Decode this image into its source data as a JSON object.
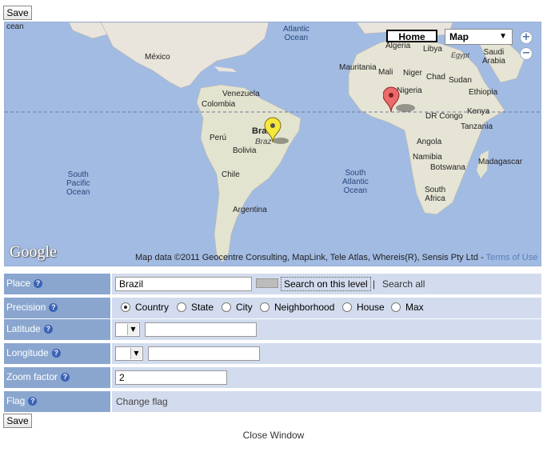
{
  "toolbar": {
    "save_label": "Save"
  },
  "map": {
    "home_label": "Home",
    "map_type": "Map",
    "map_type_arrow": "▼",
    "zoom_in": "+",
    "zoom_out": "−",
    "google_logo": "Google",
    "attribution": "Map data ©2011 Geocentre Consulting, MapLink, Tele Atlas, Whereis(R), Sensis Pty Ltd - ",
    "terms_link": "Terms of Use",
    "labels": {
      "ocean_left": "cean",
      "atlantic_ocean": [
        "Atlantic",
        "Ocean"
      ],
      "mexico": "México",
      "venezuela": "Venezuela",
      "colombia": "Colombia",
      "peru": "Perú",
      "brazil": "Bras",
      "brazil_italic": "Braz",
      "bolivia": "Bolivia",
      "chile": "Chile",
      "argentina": "Argentina",
      "south_pacific": [
        "South",
        "Pacific",
        "Ocean"
      ],
      "south_atlantic": [
        "South",
        "Atlantic",
        "Ocean"
      ],
      "algeria": "Algeria",
      "libya": "Libya",
      "egypt": "Egypt",
      "saudi_arabia": [
        "Saudi",
        "Arabia"
      ],
      "mauritania": "Mauritania",
      "mali": "Mali",
      "niger": "Niger",
      "chad": "Chad",
      "sudan": "Sudan",
      "nigeria": "Nigeria",
      "ethiopia": "Ethiopia",
      "dr_congo": "DR Congo",
      "kenya": "Kenya",
      "tanzania": "Tanzania",
      "angola": "Angola",
      "namibia": "Namibia",
      "botswana": "Botswana",
      "madagascar": "Madagascar",
      "south_africa": [
        "South",
        "Africa"
      ]
    }
  },
  "form": {
    "place": {
      "label": "Place",
      "value": "Brazil",
      "search_level": "Search on this level",
      "separator": "|",
      "search_all": "Search all"
    },
    "precision": {
      "label": "Precision",
      "options": [
        "Country",
        "State",
        "City",
        "Neighborhood",
        "House",
        "Max"
      ],
      "selected": "Country"
    },
    "latitude": {
      "label": "Latitude",
      "value": ""
    },
    "longitude": {
      "label": "Longitude",
      "value": ""
    },
    "zoom_factor": {
      "label": "Zoom factor",
      "value": "2"
    },
    "flag": {
      "label": "Flag",
      "link": "Change flag"
    }
  },
  "help_icon": "?",
  "footer": {
    "close_label": "Close Window"
  }
}
